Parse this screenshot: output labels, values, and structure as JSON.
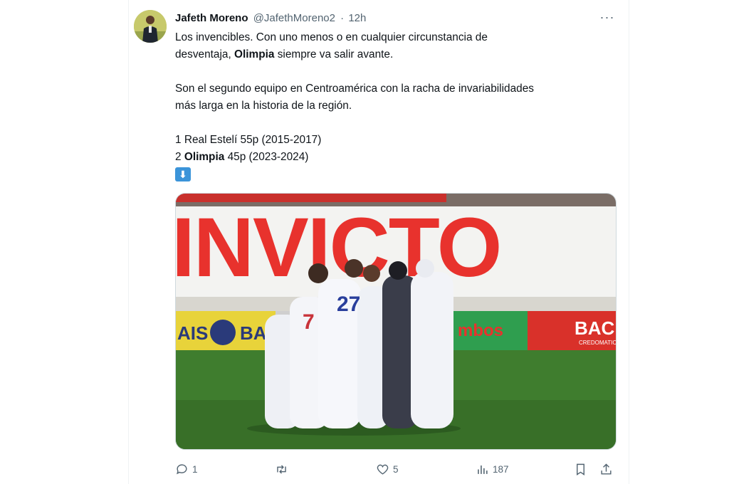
{
  "tweet": {
    "author_name": "Jafeth Moreno",
    "handle": "@JafethMoreno2",
    "separator": "·",
    "time": "12h",
    "more_label": "···",
    "line1": "Los invencibles. Con uno menos o en cualquier circunstancia de",
    "line2_pre": "desventaja, ",
    "line2_bold": "Olimpia",
    "line2_post": " siempre va salir avante.",
    "line3": "Son el segundo equipo en Centroamérica con la racha de invariabilidades",
    "line4": "más larga en la historia de la región.",
    "line5": "1 Real Estelí 55p (2015-2017)",
    "line6_pre": "2 ",
    "line6_bold": "Olimpia",
    "line6_post": " 45p (2023-2024)",
    "emoji_label": "⬇"
  },
  "media": {
    "banner_text": "INVICTO",
    "ad_left": "AIS",
    "ad_left2": "BAN",
    "ad_mid": "mbos",
    "ad_right": "BAC",
    "ad_right_sub": "CREDOMATIC",
    "jersey_numbers": [
      "7",
      "27"
    ]
  },
  "actions": {
    "reply_count": "1",
    "like_count": "5",
    "views_count": "187"
  },
  "colors": {
    "text": "#0f1419",
    "secondary": "#536471",
    "banner_red": "#e8322d",
    "banner_blue": "#1d4f9b",
    "pitch_green": "#3f7d2e"
  }
}
